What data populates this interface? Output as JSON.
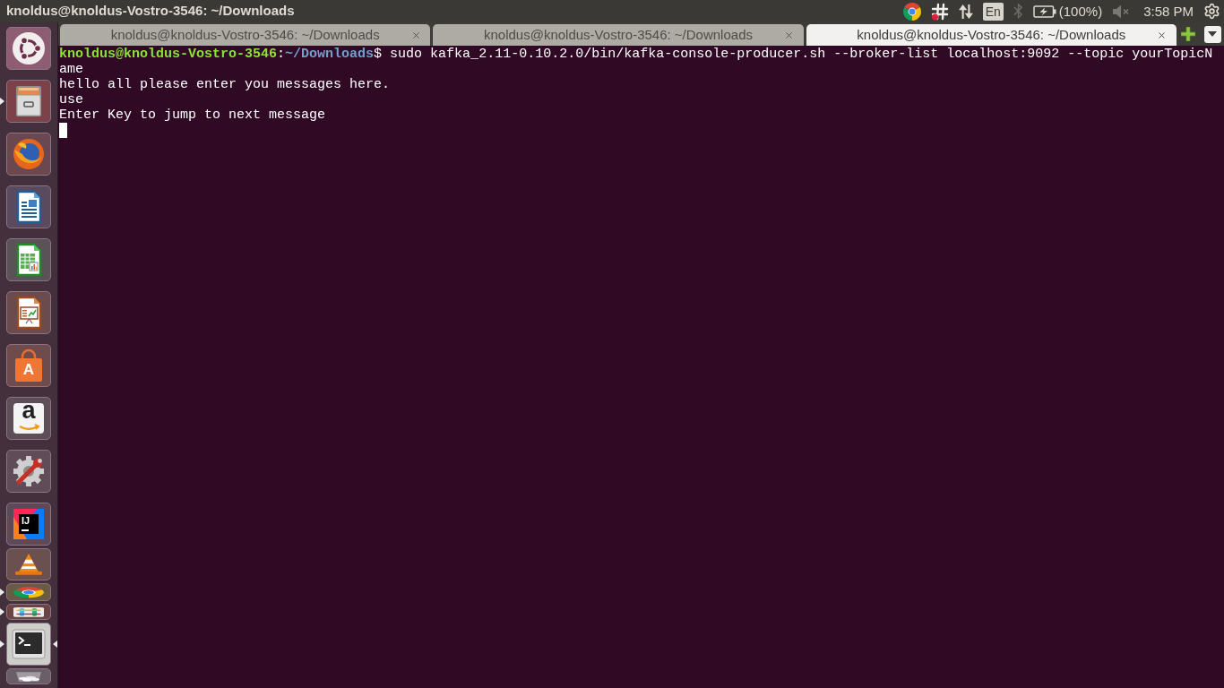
{
  "panel": {
    "title": "knoldus@knoldus-Vostro-3546: ~/Downloads",
    "indicators": [
      {
        "kind": "chrome"
      },
      {
        "kind": "slack"
      },
      {
        "kind": "network"
      },
      {
        "kind": "keyboard",
        "label": "En"
      },
      {
        "kind": "bluetooth",
        "disabled": true
      },
      {
        "kind": "battery",
        "charging": true,
        "label": "(100%)"
      },
      {
        "kind": "volume",
        "muted": true
      },
      {
        "kind": "clock",
        "label": "3:58 PM"
      },
      {
        "kind": "session"
      }
    ]
  },
  "launcher": {
    "items": [
      {
        "kind": "dash",
        "running": false,
        "focused": false,
        "folded": false
      },
      {
        "kind": "files",
        "running": true,
        "focused": false,
        "folded": false
      },
      {
        "kind": "firefox",
        "running": false,
        "focused": false,
        "folded": false
      },
      {
        "kind": "writer",
        "running": false,
        "focused": false,
        "folded": false
      },
      {
        "kind": "calc",
        "running": false,
        "focused": false,
        "folded": false
      },
      {
        "kind": "impress",
        "running": false,
        "focused": false,
        "folded": false
      },
      {
        "kind": "software",
        "glyph": "A",
        "running": false,
        "focused": false,
        "folded": false
      },
      {
        "kind": "amazon",
        "glyph": "a",
        "running": false,
        "focused": false,
        "folded": false
      },
      {
        "kind": "settings",
        "running": false,
        "focused": false,
        "folded": false
      },
      {
        "kind": "intellij",
        "glyph": "IJ",
        "running": false,
        "focused": false,
        "folded": false
      },
      {
        "kind": "vlc",
        "running": false,
        "focused": false,
        "folded": true
      },
      {
        "kind": "chrome",
        "running": true,
        "focused": false,
        "folded": true
      },
      {
        "kind": "slack",
        "running": true,
        "focused": false,
        "folded": true
      },
      {
        "kind": "terminal",
        "running": true,
        "focused": true,
        "folded": false
      },
      {
        "kind": "trash",
        "running": false,
        "focused": false,
        "folded": true
      }
    ]
  },
  "terminal": {
    "tabs": [
      {
        "title": "knoldus@knoldus-Vostro-3546: ~/Downloads",
        "selected": false
      },
      {
        "title": "knoldus@knoldus-Vostro-3546: ~/Downloads",
        "selected": false
      },
      {
        "title": "knoldus@knoldus-Vostro-3546: ~/Downloads",
        "selected": true
      }
    ],
    "lines": [
      {
        "kind": "prompt",
        "user_host": "knoldus@knoldus-Vostro-3546",
        "separator": ":",
        "path": "~/Downloads",
        "symbol": "$",
        "command": "sudo kafka_2.11-0.10.2.0/bin/kafka-console-producer.sh --broker-list localhost:9092 --topic yourTopicN"
      },
      {
        "kind": "wrap",
        "text": "ame"
      },
      {
        "kind": "output",
        "text": "hello all please enter you messages here."
      },
      {
        "kind": "output",
        "text": "use"
      },
      {
        "kind": "output",
        "text": "Enter Key to jump to next message"
      },
      {
        "kind": "cursor"
      }
    ]
  }
}
